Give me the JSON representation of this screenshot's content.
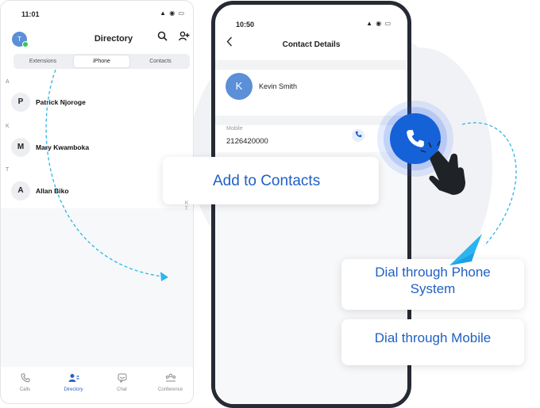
{
  "left_phone": {
    "time": "11:01",
    "status_icons": "▲ ◉ ▭",
    "avatar_initial": "T",
    "title": "Directory",
    "tabs": [
      {
        "label": "Extensions",
        "active": false
      },
      {
        "label": "iPhone",
        "active": true
      },
      {
        "label": "Contacts",
        "active": false
      }
    ],
    "sections": [
      {
        "letter": "A",
        "contact": {
          "initial": "P",
          "name": "Patrick Njoroge"
        }
      },
      {
        "letter": "K",
        "contact": {
          "initial": "M",
          "name": "Mary Kwamboka"
        }
      },
      {
        "letter": "T",
        "contact": {
          "initial": "A",
          "name": "Allan Biko"
        }
      }
    ],
    "bottom_tabs": [
      {
        "label": "Calls",
        "icon": "phone-icon",
        "active": false
      },
      {
        "label": "Directory",
        "icon": "users-icon",
        "active": true
      },
      {
        "label": "Chat",
        "icon": "chat-icon",
        "active": false
      },
      {
        "label": "Conference",
        "icon": "conference-icon",
        "active": false
      }
    ]
  },
  "right_phone": {
    "time": "10:50",
    "status_icons": "▲ ◉ ▭",
    "title": "Contact Details",
    "contact_initial": "K",
    "contact_name": "Kevin Smith",
    "mobile_label": "Mobile",
    "mobile_number": "2126420000"
  },
  "overlay": {
    "add_to_contacts": "Add to Contacts",
    "index_letters": "K\nT",
    "dial_phone_system_line1": "Dial through Phone",
    "dial_phone_system_line2": "System",
    "dial_mobile": "Dial through Mobile"
  },
  "colors": {
    "accent": "#1561d8",
    "text_accent": "#2060c4",
    "dashed_arrow": "#2bb5f0",
    "background_circle": "#f1f2f5"
  }
}
